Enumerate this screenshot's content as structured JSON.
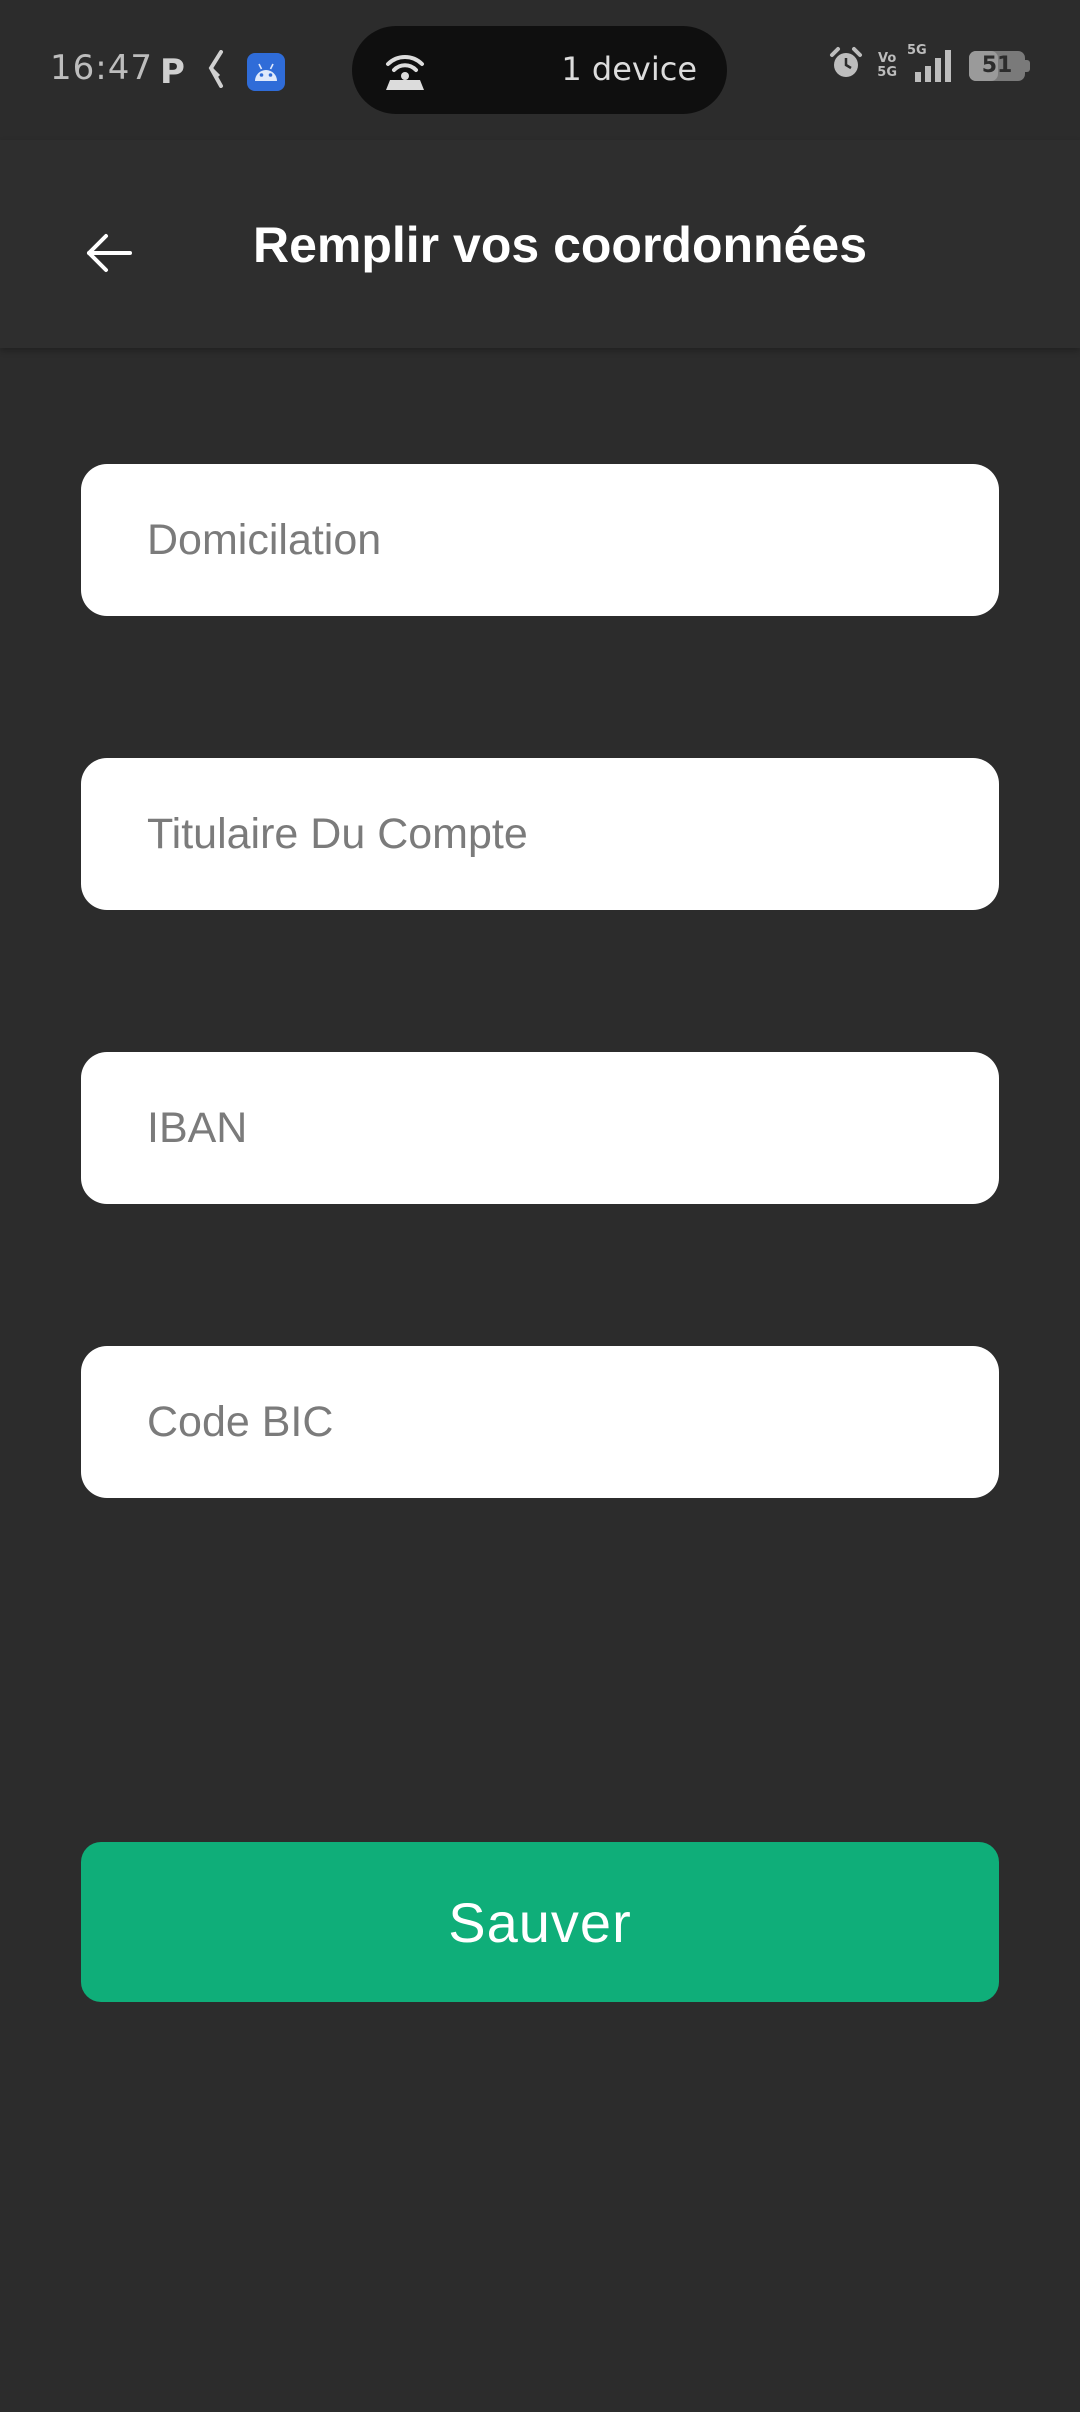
{
  "status_bar": {
    "time": "16:47",
    "left_icons": [
      "p-icon",
      "hourglass-icon",
      "android-icon"
    ],
    "p_letter": "P",
    "hotspot_text": "1 device",
    "network_volte": "Vo",
    "network_5g_small": "5G",
    "network_5g": "5G",
    "battery_level": "51"
  },
  "header": {
    "title": "Remplir vos coordonnées"
  },
  "form": {
    "domiciliation_placeholder": "Domicilation",
    "titulaire_placeholder": "Titulaire Du Compte",
    "iban_placeholder": "IBAN",
    "bic_placeholder": "Code BIC"
  },
  "actions": {
    "save_label": "Sauver"
  },
  "colors": {
    "background": "#2c2c2c",
    "accent": "#0fae79",
    "field_background": "#ffffff"
  }
}
